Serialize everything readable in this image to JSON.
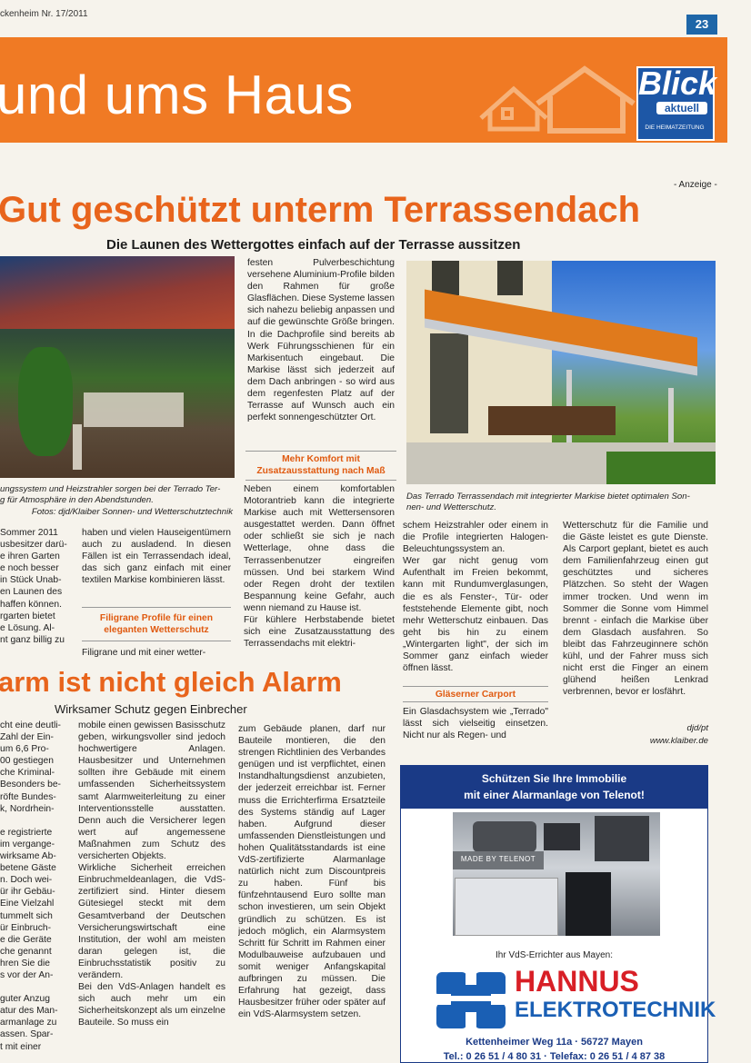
{
  "header": {
    "issue": "ckenheim Nr. 17/2011",
    "page_number": "23",
    "section_title": "und ums Haus",
    "logo_word": "Blick",
    "logo_sub": "aktuell",
    "logo_tag": "DIE HEIMATZEITUNG"
  },
  "ad_label": "- Anzeige -",
  "article1": {
    "headline": "Gut geschützt unterm Terrassendach",
    "subheadline": "Die Launen des Wettergottes einfach auf der Terrasse aussitzen",
    "caption_left": "ungssystem und Heizstrahler sorgen bei der Terrado Ter-\ng für Atmosphäre in den Abendstunden.",
    "photo_credit": "Fotos: djd/Klaiber Sonnen- und Wetterschutztechnik",
    "caption_right": "Das Terrado Terrassendach mit integrierter Markise bietet optimalen Son-\nnen- und Wetterschutz.",
    "col_mid_top": "festen Pulverbeschichtung versehene Aluminium-Profile bilden den Rahmen für große Glasflächen. Diese Systeme lassen sich nahezu beliebig anpassen und auf die gewünschte Größe bringen. In die Dachprofile sind bereits ab Werk Führungsschienen für ein Markisentuch eingebaut. Die Markise lässt sich jederzeit auf dem Dach anbringen - so wird aus dem regenfesten Platz auf der Terrasse auf Wunsch auch ein perfekt sonnengeschützter Ort.",
    "subhead_mid": "Mehr Komfort mit\nZusatzausstattung nach Maß",
    "col_mid_bottom": "Neben einem komfortablen Motorantrieb kann die integrierte Markise auch mit Wettersensoren ausgestattet werden. Dann öffnet oder schließt sie sich je nach Wetterlage, ohne dass die Terrassenbenutzer eingreifen müssen. Und bei starkem Wind oder Regen droht der textilen Bespannung keine Gefahr, auch wenn niemand zu Hause ist.\nFür kühlere Herbstabende bietet sich eine Zusatzausstattung des Terrassendachs mit elektri-",
    "col_a": "Sommer 2011\nusbesitzer darü-\ne ihren Garten\ne noch besser\nin Stück Unab-\nen Launen des\nhaffen können.\nrgarten bietet\ne Lösung. Al-\nnt ganz billig zu",
    "col_b_top": "haben und vielen Hauseigentümern auch zu ausladend. In diesen Fällen ist ein Terrassendach ideal, das sich ganz einfach mit einer textilen Markise kombinieren lässt.",
    "subhead_b": "Filigrane Profile für einen\neleganten Wetterschutz",
    "col_b_bottom": "Filigrane und mit einer wetter-",
    "col_c": "schem Heizstrahler oder einem in die Profile integrierten Halogen-Beleuchtungssystem an.\nWer gar nicht genug vom Aufenthalt im Freien bekommt, kann mit Rundumverglasungen, die es als Fenster-, Tür- oder feststehende Elemente gibt, noch mehr Wetterschutz einbauen. Das geht bis hin zu einem „Wintergarten light\", der sich im Sommer ganz einfach wieder öffnen lässt.",
    "subhead_c": "Gläserner Carport",
    "col_c_bottom": "Ein Glasdachsystem wie „Terrado\" lässt sich vielseitig einsetzen. Nicht nur als Regen- und",
    "col_d": "Wetterschutz für die Familie und die Gäste leistet es gute Dienste. Als Carport geplant, bietet es auch dem Familienfahrzeug einen gut geschütztes und sicheres Plätzchen. So steht der Wagen immer trocken. Und wenn im Sommer die Sonne vom Himmel brennt - einfach die Markise über dem Glasdach ausfahren. So bleibt das Fahrzeuginnere schön kühl, und der Fahrer muss sich nicht erst die Finger an einem glühend heißen Lenkrad verbrennen, bevor er losfährt.",
    "sig1": "djd/pt",
    "sig2": "www.klaiber.de"
  },
  "article2": {
    "headline": "arm ist nicht gleich Alarm",
    "subheadline": "Wirksamer Schutz gegen Einbrecher",
    "col_a": "cht eine deutli-\n Zahl der Ein-\n um 6,6 Pro-\n00 gestiegen\nche Kriminal-\nBesonders be-\nröfte Bundes-\nk, Nordrhein-\n\ne registrierte\nim vergange-\nwirksame Ab-\nbetene Gäste\nn. Doch wei-\nür ihr Gebäu-\nEine Vielzahl\ntummelt sich\nür Einbruch-\ne die Geräte\nche genannt\nhren Sie die\ns vor der An-\n\nguter Anzug\natur des Man-\narmanlage zu\nassen. Spar-\nt mit einer",
    "col_b": "mobile einen gewissen Basisschutz geben, wirkungsvoller sind jedoch hochwertigere Anlagen. Hausbesitzer und Unternehmen sollten ihre Gebäude mit einem umfassenden Sicherheitssystem samt Alarmweiterleitung zu einer Interventionsstelle ausstatten. Denn auch die Versicherer legen wert auf angemessene Maßnahmen zum Schutz des versicherten Objekts.\nWirkliche Sicherheit erreichen Einbruchmeldeanlagen, die VdS-zertifiziert sind. Hinter diesem Gütesiegel steckt mit dem Gesamtverband der Deutschen Versicherungswirtschaft eine Institution, der wohl am meisten daran gelegen ist, die Einbruchsstatistik positiv zu verändern.\nBei den VdS-Anlagen handelt es sich auch mehr um ein Sicherheitskonzept als um einzelne Bauteile. So muss ein",
    "col_c": "zum Gebäude planen, darf nur Bauteile montieren, die den strengen Richtlinien des Verbandes genügen und ist verpflichtet, einen Instandhaltungsdienst anzubieten, der jederzeit erreichbar ist. Ferner muss die Errichterfirma Ersatzteile des Systems ständig auf Lager haben. Aufgrund dieser umfassenden Dienstleistungen und hohen Qualitätsstandards ist eine VdS-zertifizierte Alarmanlage natürlich nicht zum Discountpreis zu haben. Fünf bis fünfzehntausend Euro sollte man schon investieren, um sein Objekt gründlich zu schützen. Es ist jedoch möglich, ein Alarmsystem Schritt für Schritt im Rahmen einer Modulbauweise aufzubauen und somit weniger Anfangskapital aufbringen zu müssen. Die Erfahrung hat gezeigt, dass Hausbesitzer früher oder später auf ein VdS-Alarmsystem setzen."
  },
  "advert": {
    "headline1": "Schützen Sie Ihre Immobilie",
    "headline2": "mit einer Alarmanlage von Telenot!",
    "made_by": "MADE BY TELENOT",
    "errichter": "Ihr VdS-Errichter aus Mayen:",
    "company1": "HANNUS",
    "company2": "ELEKTROTECHNIK",
    "address": "Kettenheimer Weg 11a · 56727 Mayen",
    "phone": "Tel.: 0 26 51 / 4 80 31 · Telefax: 0 26 51 / 4 87 38"
  },
  "colors": {
    "orange": "#f07a24",
    "accent": "#e8641c",
    "navy": "#1a3a86",
    "red": "#d81f26"
  }
}
